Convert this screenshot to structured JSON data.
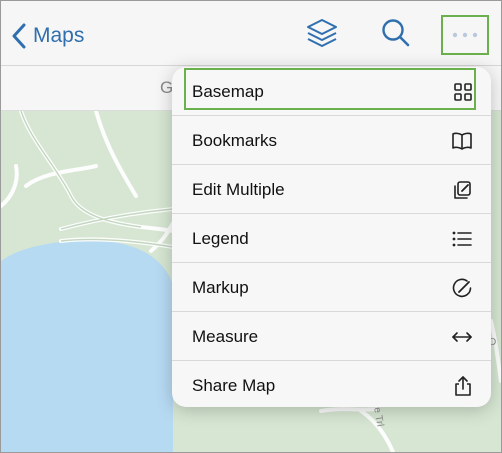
{
  "header": {
    "back_label": "Maps"
  },
  "subbar": {
    "partial_text": "G"
  },
  "map": {
    "label_fragment_right": "D",
    "trail_label_fragment": "ne Trl",
    "colors": {
      "land": "#d7e6d3",
      "water": "#b7daf3",
      "road": "#ffffff"
    }
  },
  "menu": {
    "items": [
      {
        "label": "Basemap",
        "icon": "grid-icon"
      },
      {
        "label": "Bookmarks",
        "icon": "book-icon"
      },
      {
        "label": "Edit Multiple",
        "icon": "edit-multiple-icon"
      },
      {
        "label": "Legend",
        "icon": "list-icon"
      },
      {
        "label": "Markup",
        "icon": "markup-icon"
      },
      {
        "label": "Measure",
        "icon": "measure-arrows-icon"
      },
      {
        "label": "Share Map",
        "icon": "share-icon"
      }
    ],
    "highlighted_item": "Basemap"
  },
  "colors": {
    "accent": "#2f6fae",
    "highlight": "#6ab04c",
    "toolbar_bg": "#f6f6f6",
    "menu_bg": "#f7f7f7"
  }
}
